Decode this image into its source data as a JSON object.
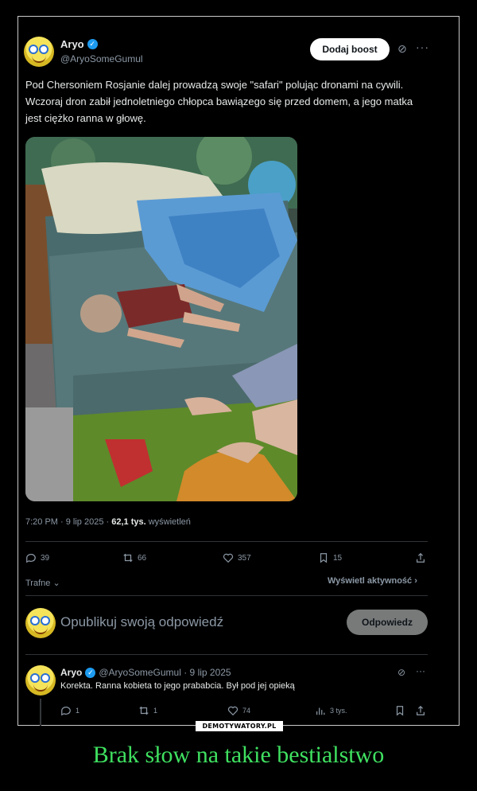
{
  "post": {
    "author_name": "Aryo",
    "author_handle": "@AryoSomeGumul",
    "boost_label": "Dodaj boost",
    "text": "Pod Chersoniem Rosjanie dalej prowadzą swoje \"safari\" polując dronami na cywili. Wczoraj dron zabił jednoletniego chłopca bawiązego się przed domem, a jego matka jest ciężko ranna w głowę.",
    "time": "7:20 PM · 9 lip 2025 · ",
    "views_count": "62,1 tys.",
    "views_label": " wyświetleń",
    "replies": "39",
    "reposts": "66",
    "likes": "357",
    "bookmarks": "15",
    "sort_label": "Trafne",
    "activity_label": "Wyświetl aktywność"
  },
  "reply_box": {
    "placeholder": "Opublikuj swoją odpowiedź",
    "button_label": "Odpowiedz"
  },
  "comment": {
    "author_name": "Aryo",
    "author_handle": "@AryoSomeGumul · 9 lip 2025",
    "text": "Korekta. Ranna kobieta to jego prababcia. Był pod jej opieką",
    "replies": "1",
    "reposts": "1",
    "likes": "74",
    "views": "3 tys."
  },
  "watermark": "DEMOTYWATORY.PL",
  "caption": "Brak słow na takie bestialstwo",
  "colors": {
    "caption": "#3fe060",
    "verified": "#1d9bf0",
    "background": "#000000"
  }
}
